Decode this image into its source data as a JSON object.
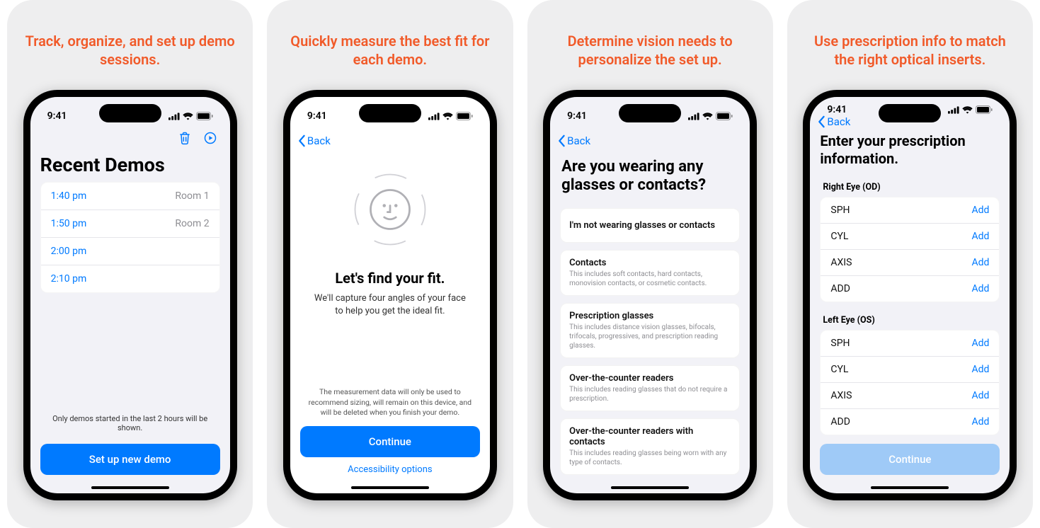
{
  "captions": [
    "Track, organize, and set up demo sessions.",
    "Quickly measure the best fit for each demo.",
    "Determine vision needs to personalize the set up.",
    "Use prescription info to match the right optical inserts."
  ],
  "status": {
    "time": "9:41"
  },
  "nav": {
    "back": "Back"
  },
  "screen1": {
    "title": "Recent Demos",
    "rows": [
      {
        "time": "1:40 pm",
        "room": "Room 1"
      },
      {
        "time": "1:50 pm",
        "room": "Room 2"
      },
      {
        "time": "2:00 pm",
        "room": ""
      },
      {
        "time": "2:10 pm",
        "room": ""
      }
    ],
    "footer": "Only demos started in the last 2 hours will be shown.",
    "cta": "Set up new demo"
  },
  "screen2": {
    "title": "Let's find your fit.",
    "subtitle": "We'll capture four angles of your face to help you get the ideal fit.",
    "disclaimer": "The measurement data will only be used to recommend sizing, will remain on this device, and will be deleted when you finish your demo.",
    "cta": "Continue",
    "accessibility": "Accessibility options"
  },
  "screen3": {
    "title": "Are you wearing any glasses or contacts?",
    "options": [
      {
        "title": "I'm not wearing glasses or contacts",
        "sub": ""
      },
      {
        "title": "Contacts",
        "sub": "This includes soft contacts, hard contacts, monovision contacts, or cosmetic contacts."
      },
      {
        "title": "Prescription glasses",
        "sub": "This includes distance vision glasses, bifocals, trifocals, progressives, and prescription reading glasses."
      },
      {
        "title": "Over-the-counter readers",
        "sub": "This includes reading glasses that do not require a prescription."
      },
      {
        "title": "Over-the-counter readers with contacts",
        "sub": "This includes reading glasses being worn with any type of contacts."
      }
    ]
  },
  "screen4": {
    "title": "Enter your prescription information.",
    "groups": [
      {
        "label": "Right Eye (OD)",
        "fields": [
          "SPH",
          "CYL",
          "AXIS",
          "ADD"
        ]
      },
      {
        "label": "Left Eye (OS)",
        "fields": [
          "SPH",
          "CYL",
          "AXIS",
          "ADD"
        ]
      }
    ],
    "action": "Add",
    "cta": "Continue"
  }
}
